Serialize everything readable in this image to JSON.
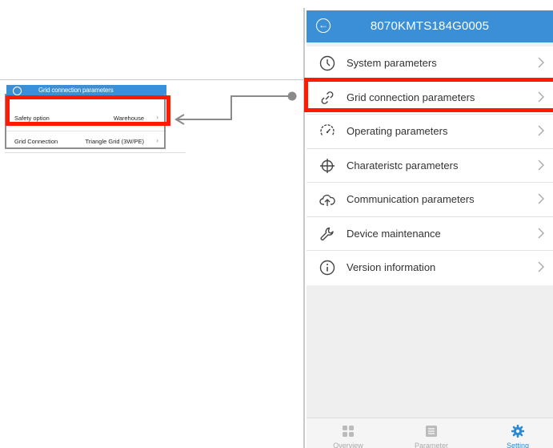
{
  "inset": {
    "header_title": "Grid connection parameters",
    "rows": [
      {
        "label": "Safety option",
        "value": "Warehouse"
      },
      {
        "label": "Grid Connection",
        "value": "Triangle Grid (3W/PE)"
      }
    ]
  },
  "app": {
    "title": "8070KMTS184G0005",
    "menu": [
      {
        "label": "System parameters",
        "icon": "clock-icon"
      },
      {
        "label": "Grid connection parameters",
        "icon": "link-icon"
      },
      {
        "label": "Operating parameters",
        "icon": "gauge-icon"
      },
      {
        "label": "Charateristc parameters",
        "icon": "crosshair-icon"
      },
      {
        "label": "Communication parameters",
        "icon": "cloud-upload-icon"
      },
      {
        "label": "Device maintenance",
        "icon": "wrench-icon"
      },
      {
        "label": "Version information",
        "icon": "info-icon"
      }
    ],
    "tabs": [
      {
        "label": "Overview",
        "icon": "grid-icon"
      },
      {
        "label": "Parameter",
        "icon": "list-icon"
      },
      {
        "label": "Setting",
        "icon": "gear-icon"
      }
    ]
  },
  "colors": {
    "accent": "#3a8fd6",
    "highlight": "#ff1a00",
    "active_tab": "#2b8ad6"
  }
}
